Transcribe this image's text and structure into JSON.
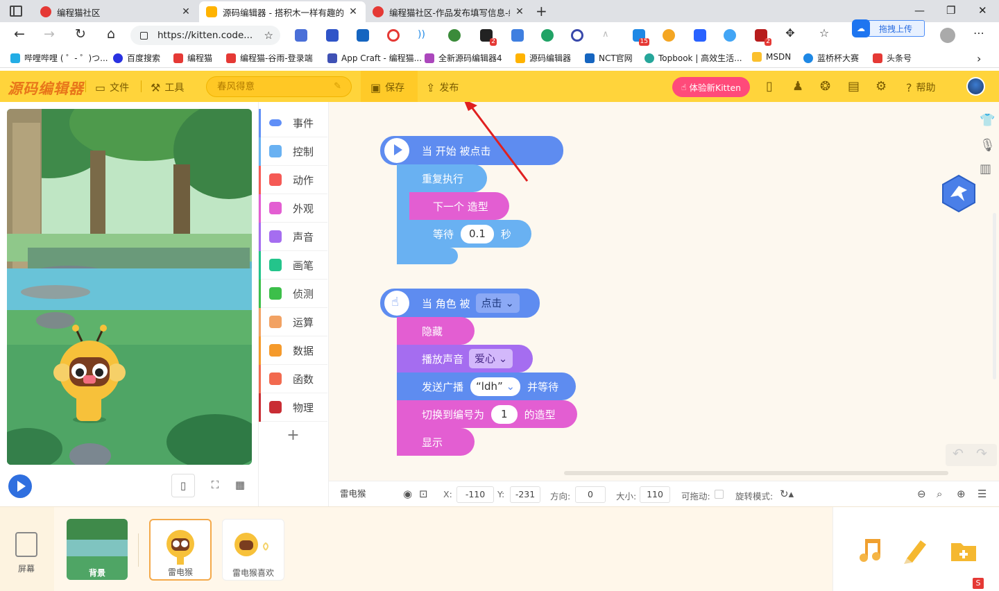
{
  "browser": {
    "tabs": [
      {
        "title": "编程猫社区",
        "close": "✕"
      },
      {
        "title": "源码编辑器 - 搭积木一样有趣的编",
        "close": "✕"
      },
      {
        "title": "编程猫社区-作品发布填写信息-编",
        "close": "✕"
      }
    ],
    "new_tab": "+",
    "url": "https://kitten.code...",
    "upload_label": "拖拽上传",
    "bookmarks": [
      "哔哩哔哩 ( ゜- ゜)つ...",
      "百度搜索",
      "编程猫",
      "编程猫-谷雨-登录端",
      "App Craft - 编程猫...",
      "全新源码编辑器4",
      "源码编辑器",
      "NCT官网",
      "Topbook | 高效生活...",
      "MSDN",
      "蓝桥杯大赛",
      "头条号"
    ],
    "badges": {
      "ext1": "2",
      "ext2": "15",
      "ext3": "2"
    }
  },
  "editor": {
    "logo": "源码编辑器",
    "menu": {
      "file": "文件",
      "tools": "工具",
      "save": "保存",
      "publish": "发布",
      "help": "帮助"
    },
    "project_name": "春风得意",
    "try_label": "体验新Kitten",
    "categories": [
      "事件",
      "控制",
      "动作",
      "外观",
      "声音",
      "画笔",
      "侦测",
      "运算",
      "数据",
      "函数",
      "物理"
    ],
    "cat_add": "+",
    "category_colors": [
      "#608ff7",
      "#69b1f2",
      "#f55a55",
      "#e35ed2",
      "#a56df0",
      "#24c48b",
      "#3cbf4a",
      "#f2a263",
      "#f59a2b",
      "#f26a4f",
      "#c92d34"
    ]
  },
  "blocks": {
    "script1": {
      "hat": "当 开始 被点击",
      "forever": "重复执行",
      "next_costume": "下一个 造型",
      "wait_prefix": "等待",
      "wait_value": "0.1",
      "wait_suffix": "秒"
    },
    "script2": {
      "hat_prefix": "当 角色 被",
      "hat_option": "点击",
      "hide": "隐藏",
      "play_sound": "播放声音",
      "sound_option": "爱心",
      "broadcast": "发送广播",
      "broadcast_option": "“ldh”",
      "broadcast_suffix": "并等待",
      "switch_prefix": "切换到编号为",
      "switch_value": "1",
      "switch_suffix": "的造型",
      "show": "显示"
    }
  },
  "properties": {
    "sprite_name": "雷电猴",
    "x_label": "X:",
    "x_value": "-110",
    "y_label": "Y:",
    "y_value": "-231",
    "dir_label": "方向:",
    "dir_value": "0",
    "size_label": "大小:",
    "size_value": "110",
    "draggable_label": "可拖动:",
    "rotation_label": "旋转模式:"
  },
  "sprites": {
    "screen_label": "屏幕",
    "items": [
      "背景",
      "雷电猴",
      "雷电猴喜欢"
    ]
  }
}
